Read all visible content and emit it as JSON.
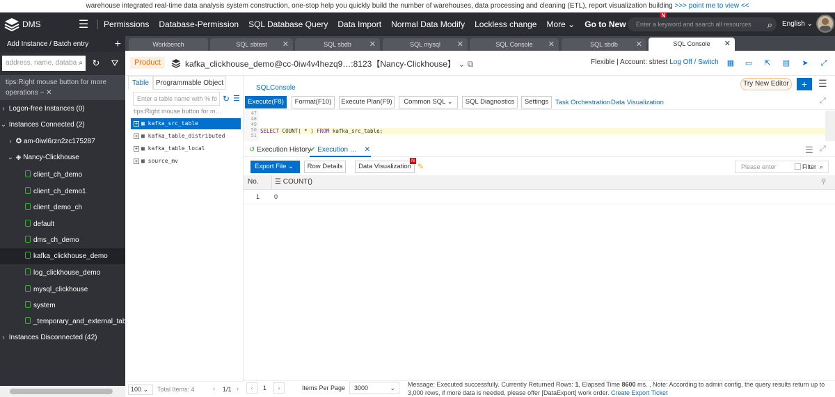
{
  "banner": {
    "text": "warehouse integrated real-time data analysis system construction, one-stop help you quickly build the number of warehouses, data processing and cleaning (ETL), report visualization building",
    "link": ">>> point me to view <<"
  },
  "topnav": {
    "logo": "DMS",
    "items": [
      "Permissions",
      "Database-Permission",
      "SQL Database Query",
      "Data Import",
      "Normal Data Modify",
      "Lockless change",
      "More"
    ],
    "goto_new": "Go to New Version",
    "new_badge": "N",
    "search_placeholder": "Enter a keyword and search all resources",
    "language": "English"
  },
  "sidebar": {
    "header": "Add Instance / Batch entry",
    "search_placeholder": "address, name, databa",
    "tips": "tips:Right mouse button for more operations ~",
    "groups": {
      "logon_free": "Logon-free Instances  (0)",
      "connected": "Instances Connected  (2)",
      "disconnected": "Instances Disconnected  (42)"
    },
    "instances": [
      "am-0iwl6rzn2zc175287",
      "Nancy-Clickhouse"
    ],
    "databases": [
      "client_ch_demo",
      "client_ch_demo1",
      "client_demo_ch",
      "default",
      "dms_ch_demo",
      "kafka_clickhouse_demo",
      "log_clickhouse_demo",
      "mysql_clickhouse",
      "system",
      "_temporary_and_external_tables"
    ]
  },
  "tabs": [
    {
      "label": "Workbench"
    },
    {
      "label": "SQL sbtest"
    },
    {
      "label": "SQL sbdb"
    },
    {
      "label": "SQL mysql"
    },
    {
      "label": "SQL Console"
    },
    {
      "label": "SQL sbdb"
    },
    {
      "label": "SQL Console"
    }
  ],
  "product_bar": {
    "product": "Product",
    "instance": "kafka_clickhouse_demo@cc-0iw4v4hezq9…:8123【Nancy-Clickhouse】",
    "account": "Flexible | Account: sbtest",
    "logoff": "Log Off",
    "slash": "/",
    "switch": "Switch"
  },
  "object_panel": {
    "tabs": [
      "Table",
      "Programmable Object"
    ],
    "search_placeholder": "Enter a table name with % fo",
    "tips": "tips:Right mouse button for m…",
    "tables": [
      "kafka_src_table",
      "kafka_table_distributed",
      "kafka_table_local",
      "source_mv"
    ],
    "page_size": "100",
    "total": "Total Items: 4",
    "page": "1/1"
  },
  "console": {
    "tab": "SQLConsole",
    "try_new": "Try New Editor",
    "buttons": [
      "Execute(F8)",
      "Format(F10)",
      "Execute Plan(F9)",
      "Common SQL",
      "SQL Diagnostics",
      "Settings"
    ],
    "links": [
      "Task Orchestration",
      "Data Visualization"
    ],
    "line_numbers": [
      "47",
      "48",
      "49",
      "50",
      "51"
    ],
    "sql": {
      "kw1": "SELECT",
      "fn": "COUNT",
      "args": "( * )",
      "kw2": "FROM",
      "rest": "kafka_src_table;"
    }
  },
  "results": {
    "history_tab": "Execution History",
    "exec_tab": "Execution …",
    "export": "Export File",
    "row_details": "Row Details",
    "data_vis": "Data Visualization",
    "filter_placeholder": "Please enter",
    "filter_label": "Filter",
    "columns": [
      "No.",
      "COUNT()"
    ],
    "rows": [
      {
        "no": "1",
        "count": "0"
      }
    ],
    "pager_page": "1",
    "items_per_page_label": "Items Per Page",
    "items_per_page": "3000",
    "message_prefix": "Message: Executed successfully. Currently Returned Rows: ",
    "rows_count": "1",
    "message_mid": ", Elapsed Time ",
    "elapsed": "8600",
    "message_suffix": " ms. ,  Note: According to admin config, the query results return up to 3,000 rows, if more data is needed, please offer [DataExport] work order.",
    "export_ticket": "Create Export Ticket"
  }
}
